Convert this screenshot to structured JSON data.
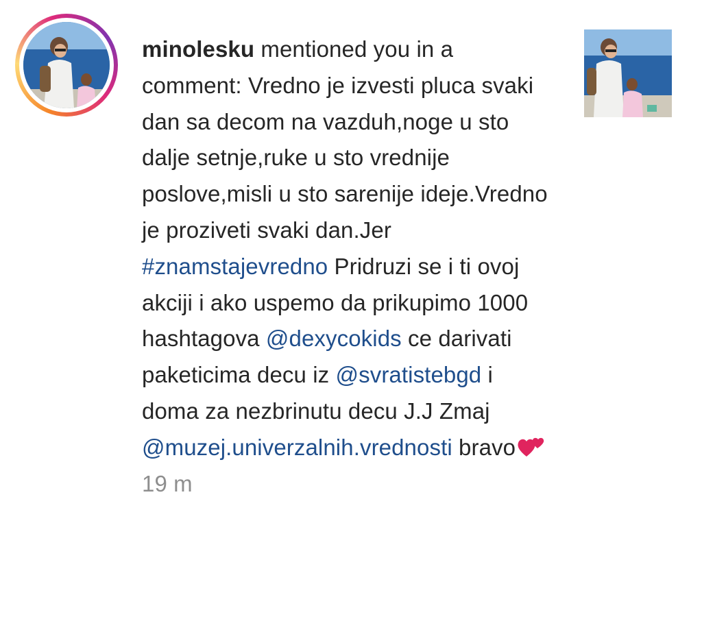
{
  "notification": {
    "username": "minolesku",
    "action": " mentioned you in a comment: ",
    "segments": [
      {
        "type": "text",
        "value": "Vredno je izvesti pluca svaki dan sa decom na vazduh,noge u sto dalje setnje,ruke u sto vrednije poslove,misli u sto sarenije ideje.Vredno je proziveti svaki dan.Jer "
      },
      {
        "type": "hashtag",
        "value": "#znamstajevredno"
      },
      {
        "type": "text",
        "value": " Pridruzi se i ti ovoj akciji i ako uspemo da prikupimo 1000 hashtagova "
      },
      {
        "type": "mention",
        "value": "@dexycokids"
      },
      {
        "type": "text",
        "value": " ce darivati paketicima decu iz "
      },
      {
        "type": "mention",
        "value": "@svratistebgd"
      },
      {
        "type": "text",
        "value": " i doma za nezbrinutu decu J.J Zmaj "
      },
      {
        "type": "mention",
        "value": "@muzej.univerzalnih.vrednosti"
      },
      {
        "type": "text",
        "value": " bravo"
      }
    ],
    "emoji": "two-hearts-icon",
    "timestamp": "19 m"
  },
  "colors": {
    "text": "#262626",
    "link": "#1f4e8c",
    "muted": "#8e8e8e",
    "heart": "#e0245e"
  }
}
